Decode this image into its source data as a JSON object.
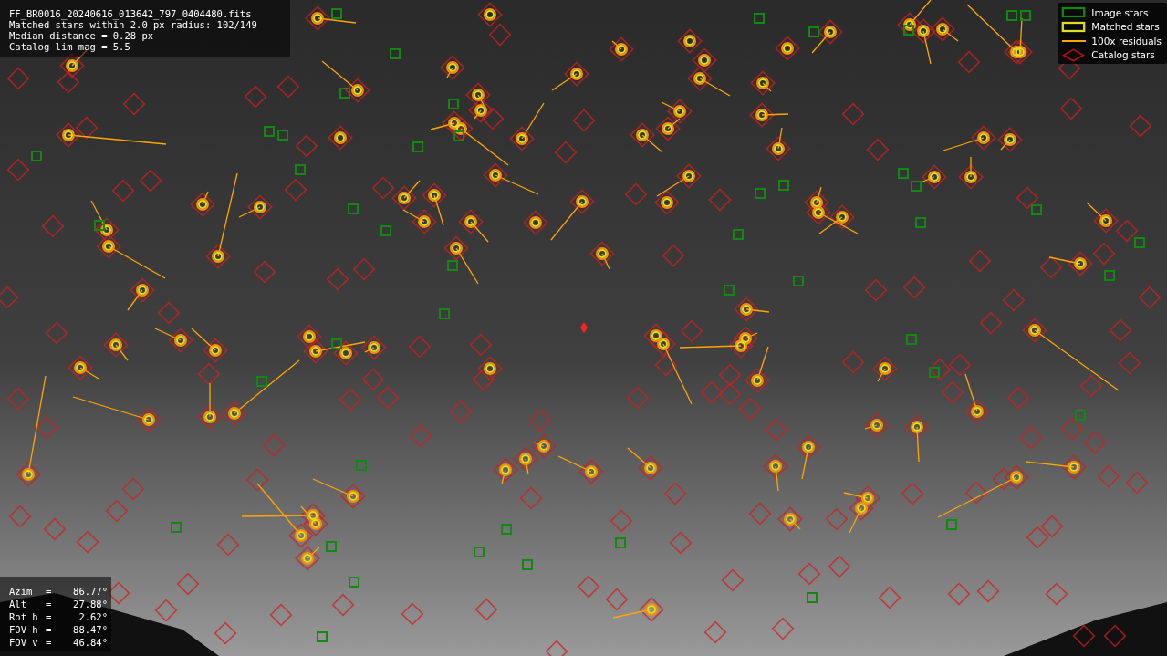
{
  "info": {
    "lines": [
      "FF_BR0016_20240616_013642_797_0404480.fits",
      "Matched stars within 2.0 px radius: 102/149",
      "Median distance = 0.28 px",
      "Catalog lim mag = 5.5"
    ]
  },
  "legend": [
    {
      "kind": "image",
      "label": "Image stars"
    },
    {
      "kind": "matched",
      "label": "Matched stars"
    },
    {
      "kind": "residual",
      "label": "100x residuals"
    },
    {
      "kind": "catalog",
      "label": "Catalog stars"
    }
  ],
  "pointing": [
    {
      "label": "Azim",
      "sep": "=",
      "value": "86.77°"
    },
    {
      "label": "Alt",
      "sep": "=",
      "value": "27.88°"
    },
    {
      "label": "Rot h",
      "sep": "=",
      "value": "2.62°"
    },
    {
      "label": "FOV h",
      "sep": "=",
      "value": "88.47°"
    },
    {
      "label": "FOV v",
      "sep": "=",
      "value": "46.84°"
    }
  ]
}
